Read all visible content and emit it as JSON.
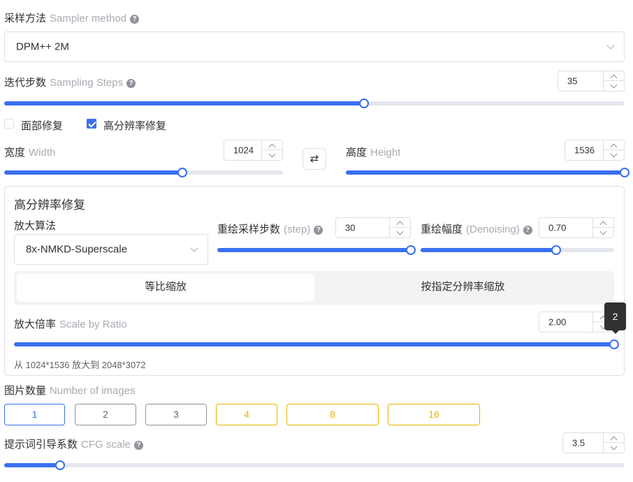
{
  "sampler": {
    "label_cn": "采样方法",
    "label_en": "Sampler method",
    "value": "DPM++ 2M"
  },
  "steps": {
    "label_cn": "迭代步数",
    "label_en": "Sampling Steps",
    "value": "35",
    "level": 0.58
  },
  "checks": {
    "face_label": "面部修复",
    "face_checked": false,
    "hires_label": "高分辨率修复",
    "hires_checked": true
  },
  "width": {
    "label_cn": "宽度",
    "label_en": "Width",
    "value": "1024",
    "level": 0.64
  },
  "swap_icon": "⇄",
  "height": {
    "label_cn": "高度",
    "label_en": "Height",
    "value": "1536",
    "level": 1.0
  },
  "hires": {
    "title": "高分辨率修复",
    "upscaler_label": "放大算法",
    "upscaler_value": "8x-NMKD-Superscale",
    "hr_steps_label_cn": "重绘采样步数",
    "hr_steps_label_en": "(step)",
    "hr_steps_value": "30",
    "hr_steps_level": 1.0,
    "denoise_label_cn": "重绘幅度",
    "denoise_label_en": "(Denoising)",
    "denoise_value": "0.70",
    "denoise_level": 0.7,
    "mode_ratio": "等比缩放",
    "mode_resolution": "按指定分辨率缩放",
    "scale_label_cn": "放大倍率",
    "scale_label_en": "Scale by Ratio",
    "scale_value": "2.00",
    "scale_level": 1.0,
    "scale_tooltip": "2",
    "scale_hint": "从 1024*1536 放大到 2048*3072"
  },
  "images": {
    "label_cn": "图片数量",
    "label_en": "Number of images",
    "options": [
      "1",
      "2",
      "3",
      "4",
      "8",
      "16"
    ],
    "selected": "1"
  },
  "cfg": {
    "label_cn": "提示词引导系数",
    "label_en": "CFG scale",
    "value": "3.5",
    "level": 0.09
  },
  "colors": {
    "accent": "#3a6ff0",
    "premium": "#e6b400"
  }
}
